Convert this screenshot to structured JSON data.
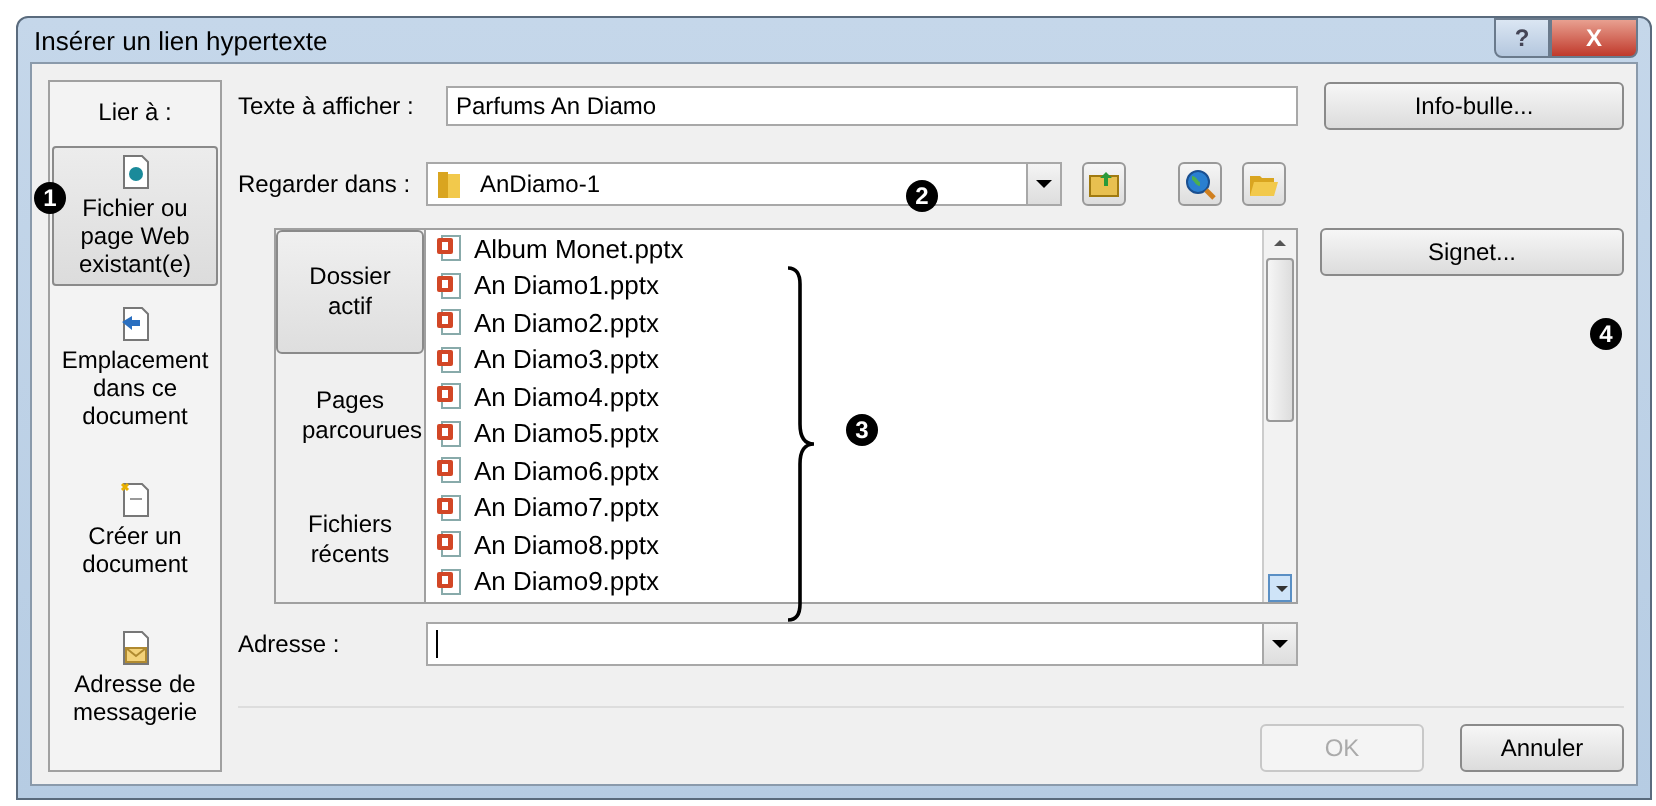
{
  "window": {
    "title": "Insérer un lien hypertexte",
    "buttons": [
      {
        "kind": "help",
        "label": "?"
      },
      {
        "kind": "close",
        "label": "X"
      }
    ]
  },
  "link_to": {
    "label": "Lier à :",
    "items": [
      {
        "kind": "file",
        "label": "Fichier ou page Web existant(e)",
        "selected": true
      },
      {
        "kind": "place",
        "label": "Emplacement dans ce document",
        "selected": false
      },
      {
        "kind": "new",
        "label": "Créer un document",
        "selected": false
      },
      {
        "kind": "email",
        "label": "Adresse de messagerie",
        "selected": false
      }
    ]
  },
  "display_text": {
    "label": "Texte à afficher :",
    "value": "Parfums An Diamo"
  },
  "tooltip_button": "Info-bulle...",
  "look_in": {
    "label": "Regarder dans :",
    "value": "AnDiamo-1"
  },
  "browse_tabs": [
    {
      "label": "Dossier actif",
      "selected": true
    },
    {
      "label": "Pages parcourues",
      "selected": false
    },
    {
      "label": "Fichiers récents",
      "selected": false
    }
  ],
  "files": [
    "Album Monet.pptx",
    "An Diamo1.pptx",
    "An Diamo2.pptx",
    "An Diamo3.pptx",
    "An Diamo4.pptx",
    "An Diamo5.pptx",
    "An Diamo6.pptx",
    "An Diamo7.pptx",
    "An Diamo8.pptx",
    "An Diamo9.pptx"
  ],
  "bookmark_button": "Signet...",
  "address": {
    "label": "Adresse :"
  },
  "ok_button": {
    "label": "OK",
    "disabled": true
  },
  "cancel_button": {
    "label": "Annuler",
    "disabled": false
  },
  "callouts": [
    "1",
    "2",
    "3",
    "4"
  ]
}
